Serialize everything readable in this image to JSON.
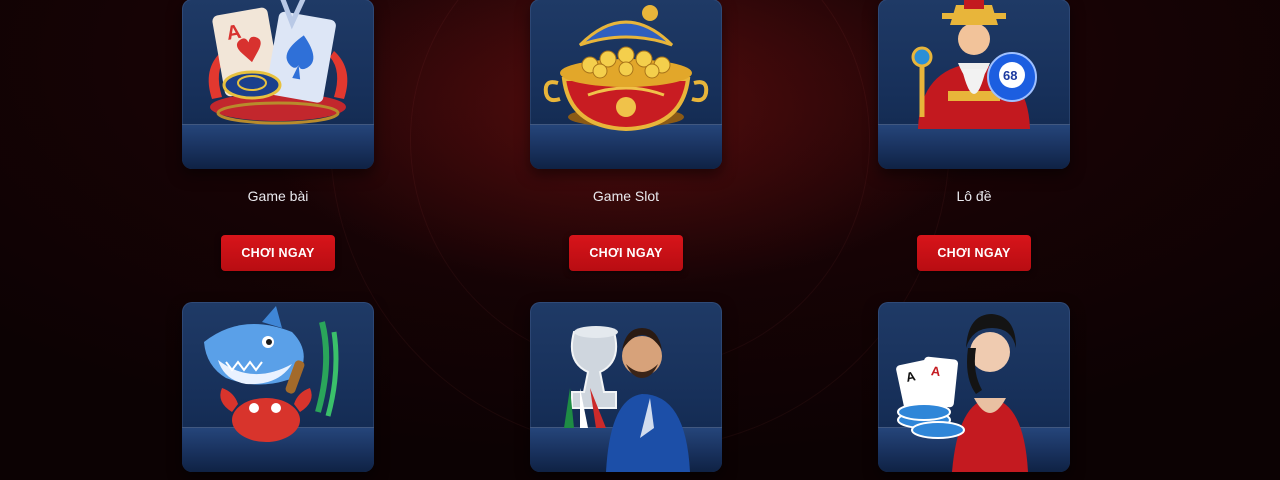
{
  "games": [
    {
      "title": "Game bài",
      "button": "CHƠI NGAY",
      "icon": "card-game-icon"
    },
    {
      "title": "Game Slot",
      "button": "CHƠI NGAY",
      "icon": "treasure-pot-icon"
    },
    {
      "title": "Lô đề",
      "button": "CHƠI NGAY",
      "icon": "fortune-god-lottery-icon"
    },
    {
      "title": "",
      "button": "",
      "icon": "shark-fishing-icon"
    },
    {
      "title": "",
      "button": "",
      "icon": "football-player-trophy-icon"
    },
    {
      "title": "",
      "button": "",
      "icon": "live-casino-dealer-icon"
    }
  ],
  "colors": {
    "button": "#c8101a",
    "card": "#1c3663",
    "background": "#160305"
  }
}
